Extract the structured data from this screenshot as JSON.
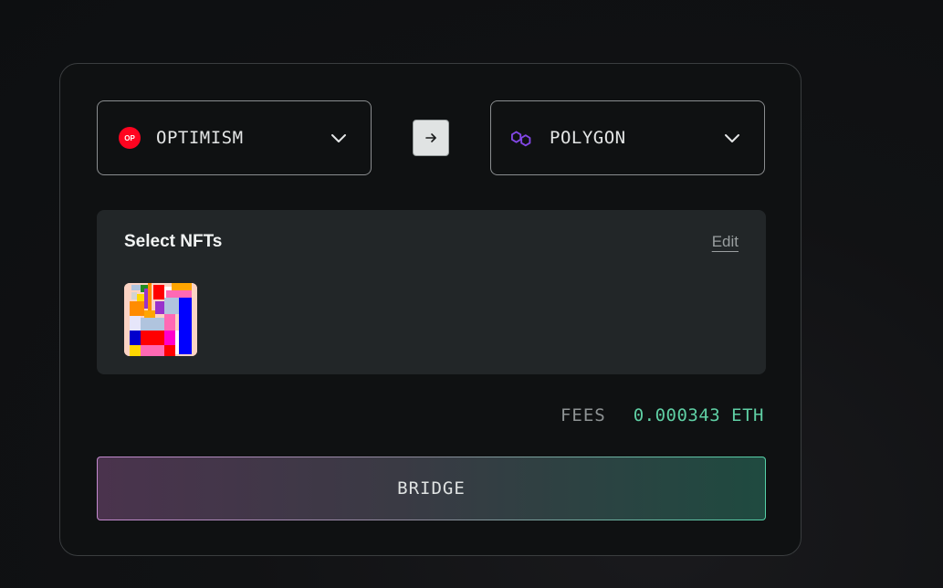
{
  "bridge_form": {
    "from_chain": {
      "label": "OPTIMISM",
      "icon": "optimism-logo",
      "icon_text": "OP",
      "icon_color": "#ff0420"
    },
    "to_chain": {
      "label": "POLYGON",
      "icon": "polygon-logo",
      "icon_color": "#8247e5"
    },
    "swap_icon": "arrow-right-icon",
    "nft_section": {
      "title": "Select NFTs",
      "edit_label": "Edit",
      "selected_count": 1
    },
    "fees": {
      "label": "FEES",
      "value": "0.000343 ETH"
    },
    "bridge_button_label": "BRIDGE"
  },
  "colors": {
    "background": "#0f1112",
    "panel": "#222628",
    "fees_value": "#5fcfa4",
    "gradient_start": "#c58ad0",
    "gradient_end": "#55d1a8"
  }
}
